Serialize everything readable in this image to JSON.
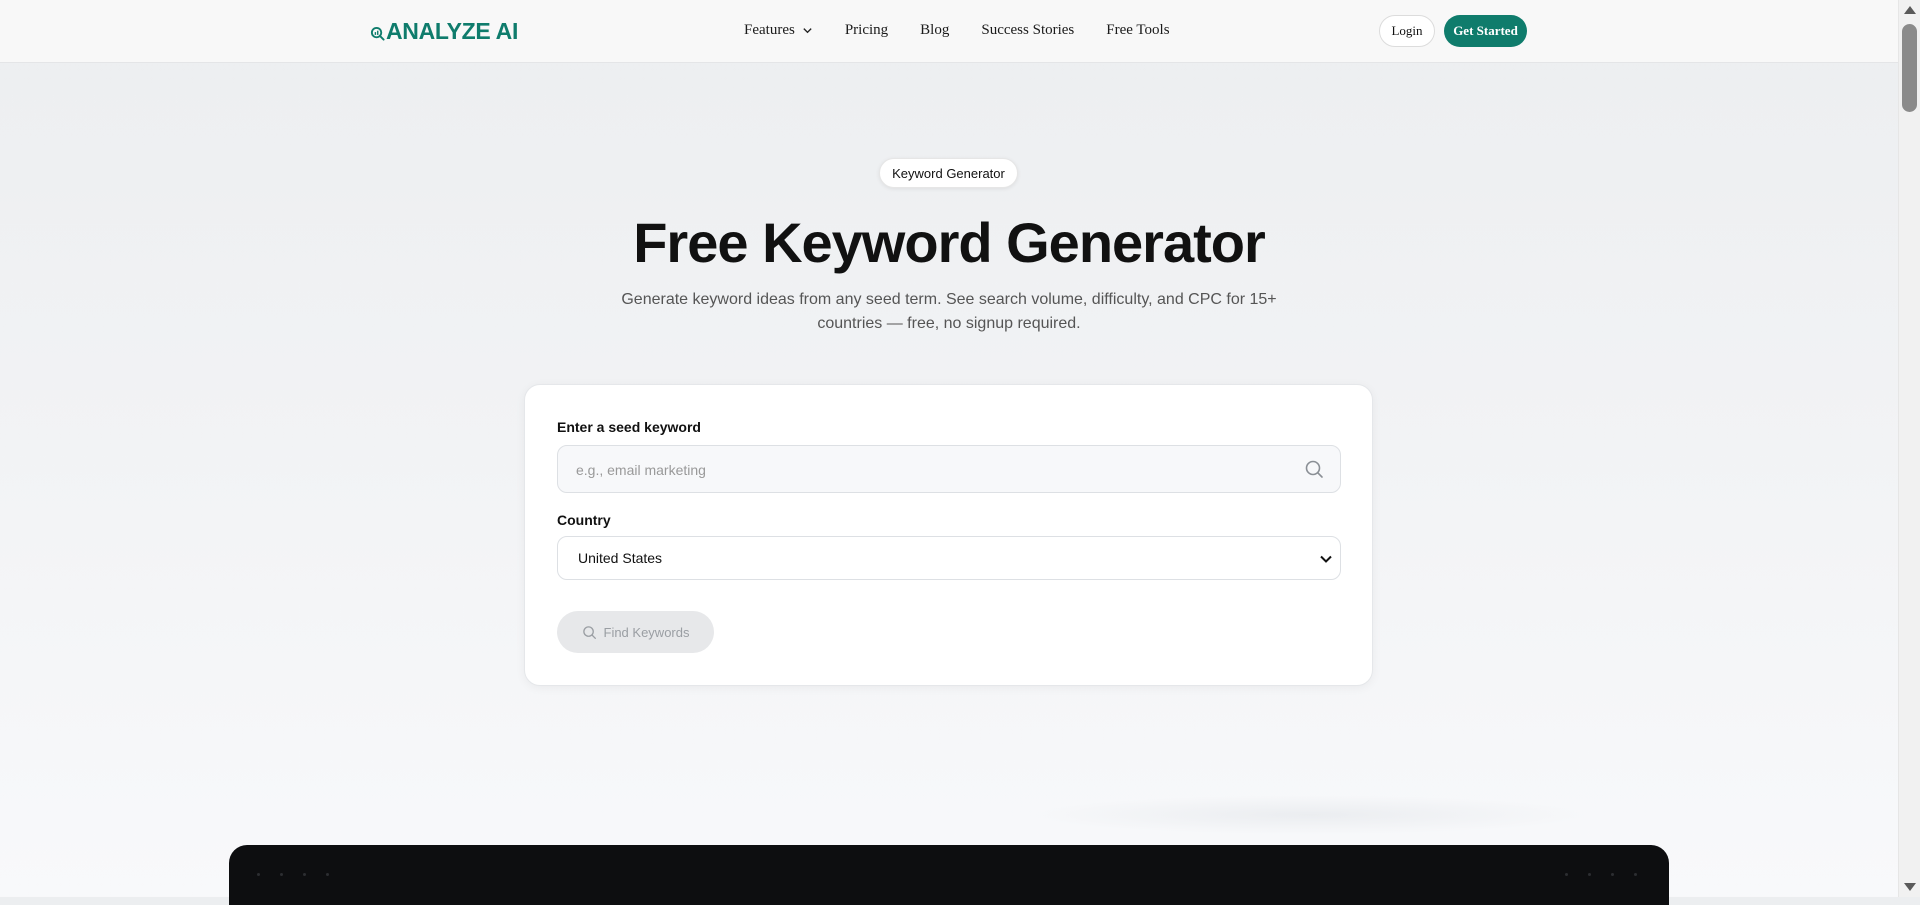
{
  "brand": {
    "name": "ANALYZE AI",
    "color": "#0f7c6c",
    "logo_icon": "magnifier-chart-icon"
  },
  "nav": {
    "items": [
      {
        "label": "Features",
        "has_dropdown": true
      },
      {
        "label": "Pricing"
      },
      {
        "label": "Blog"
      },
      {
        "label": "Success Stories"
      },
      {
        "label": "Free Tools"
      }
    ],
    "login_label": "Login",
    "cta_label": "Get Started"
  },
  "hero": {
    "badge": "Keyword Generator",
    "title": "Free Keyword Generator",
    "subtitle": "Generate keyword ideas from any seed term. See search volume, difficulty, and CPC for 15+ countries — free, no signup required."
  },
  "form": {
    "seed_label": "Enter a seed keyword",
    "seed_placeholder": "e.g., email marketing",
    "seed_value": "",
    "country_label": "Country",
    "country_value": "United States",
    "submit_label": "Find Keywords",
    "submit_disabled": true
  },
  "colors": {
    "accent": "#0f7c6c",
    "dark_panel": "#0d0e10"
  }
}
